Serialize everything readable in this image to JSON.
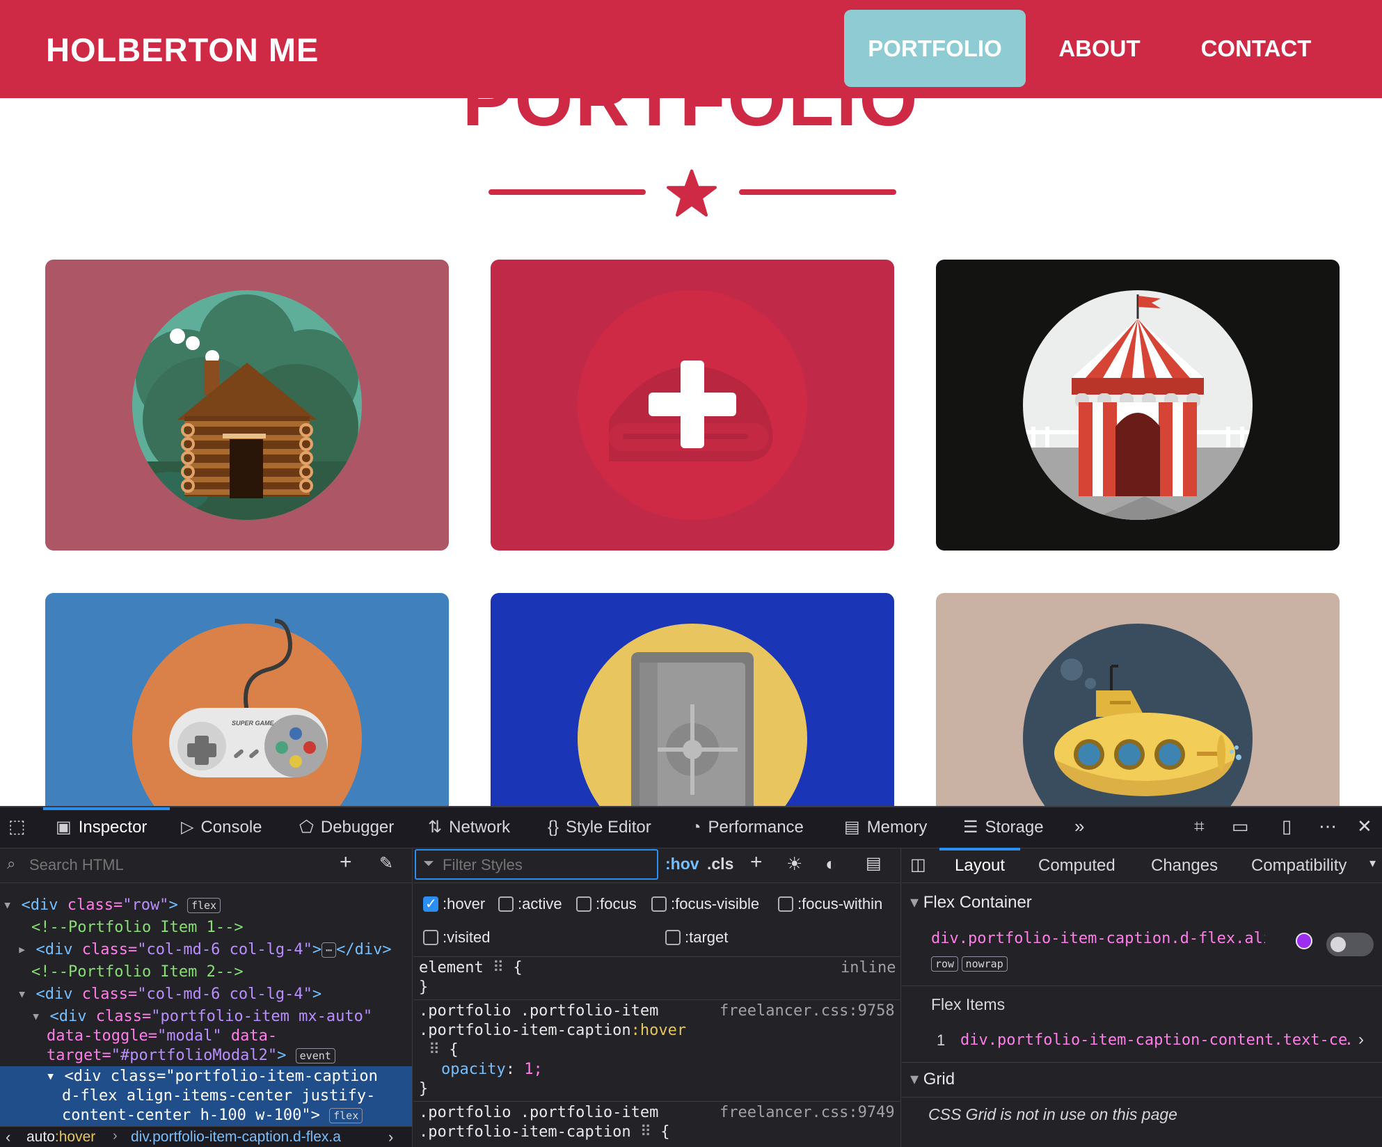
{
  "site": {
    "brand": "HOLBERTON ME",
    "nav": [
      {
        "label": "PORTFOLIO",
        "active": true
      },
      {
        "label": "ABOUT",
        "active": false
      },
      {
        "label": "CONTACT",
        "active": false
      }
    ],
    "heading": "PORTFOLIO",
    "colors": {
      "primary": "#cf2a45",
      "active_nav": "#8ecbd3"
    },
    "cards": [
      {
        "name": "cabin",
        "background": "#ad5665"
      },
      {
        "name": "cake",
        "background": "#c02a48"
      },
      {
        "name": "circus",
        "background": "#131311"
      },
      {
        "name": "game",
        "background": "#3f80bd"
      },
      {
        "name": "safe",
        "background": "#1a35b5"
      },
      {
        "name": "submarine",
        "background": "#c9b2a4"
      }
    ],
    "game_label": "SUPER GAME"
  },
  "devtools": {
    "tabs": [
      "Inspector",
      "Console",
      "Debugger",
      "Network",
      "Style Editor",
      "Performance",
      "Memory",
      "Storage"
    ],
    "active_tab": "Inspector",
    "search_placeholder": "Search HTML",
    "filter_placeholder": "Filter Styles",
    "hov": ":hov",
    "cls": ".cls",
    "pseudo": [
      {
        "label": ":hover",
        "checked": true
      },
      {
        "label": ":active",
        "checked": false
      },
      {
        "label": ":focus",
        "checked": false
      },
      {
        "label": ":focus-visible",
        "checked": false
      },
      {
        "label": ":focus-within",
        "checked": false
      },
      {
        "label": ":visited",
        "checked": false
      },
      {
        "label": ":target",
        "checked": false
      }
    ],
    "html_tree": {
      "l1_tag": "<div",
      "l1_attr": " class=",
      "l1_val": "\"row\"",
      "l1_end": ">",
      "l1_badge": "flex",
      "l2": "<!--Portfolio Item 1-->",
      "l3_tag": "<div",
      "l3_attr": " class=",
      "l3_val": "\"col-md-6 col-lg-4\"",
      "l3_end": ">",
      "l3_close": "</div>",
      "l4": "<!--Portfolio Item 2-->",
      "l5_tag": "<div",
      "l5_attr": " class=",
      "l5_val": "\"col-md-6 col-lg-4\"",
      "l5_end": ">",
      "l6_tag": "<div",
      "l6_attr": " class=",
      "l6_val": "\"portfolio-item mx-auto\"",
      "l7_attr1": "data-toggle=",
      "l7_val1": "\"modal\"",
      "l7_attr2": " data-",
      "l8_attr": "target=",
      "l8_val": "\"#portfolioModal2\"",
      "l8_end": ">",
      "l8_badge": "event",
      "l9_tag": "<div",
      "l9_attr": " class=",
      "l9_val": "\"portfolio-item-caption",
      "l10_val": "d-flex align-items-center justify-",
      "l11_val": "content-center h-100 w-100\"",
      "l11_end": ">",
      "l11_badge": "flex"
    },
    "breadcrumb": {
      "first": "auto",
      "first_pseudo": ":hover",
      "second": "div.portfolio-item-caption.d-flex.a"
    },
    "rules": [
      {
        "selector": "element",
        "braces": "{",
        "source": "inline",
        "close": "}"
      },
      {
        "selector_1": ".portfolio .portfolio-item",
        "selector_2": ".portfolio-item-caption",
        "selector_pseudo": ":hover",
        "source": "freelancer.css:9758",
        "prop": "opacity",
        "value": "1;",
        "close": "}"
      },
      {
        "selector_1": ".portfolio .portfolio-item",
        "selector_2": ".portfolio-item-caption",
        "source": "freelancer.css:9749",
        "brace": "{"
      }
    ],
    "right_tabs": [
      "Layout",
      "Computed",
      "Changes",
      "Compatibility"
    ],
    "right_active_tab": "Layout",
    "flex_container_title": "Flex Container",
    "flex_container_selector": "div.portfolio-item-caption.d-flex.ali…",
    "flex_badges": [
      "row",
      "nowrap"
    ],
    "flex_items_title": "Flex Items",
    "flex_item_index": "1",
    "flex_item_selector": "div.portfolio-item-caption-content.text-ce…",
    "grid_title": "Grid",
    "grid_message": "CSS Grid is not in use on this page"
  }
}
